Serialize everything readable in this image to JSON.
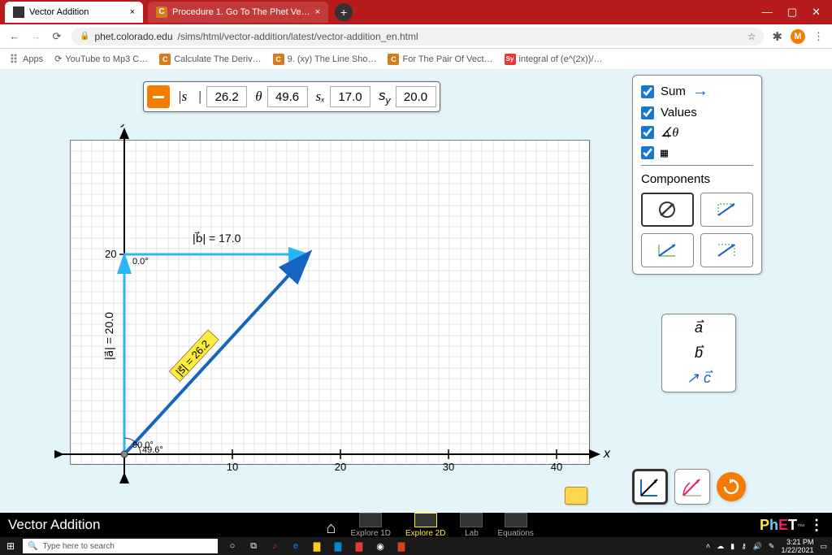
{
  "browser": {
    "tabs": [
      {
        "title": "Vector Addition",
        "icon": "phet"
      },
      {
        "title": "Procedure 1. Go To The Phet Ve…",
        "icon": "chegg"
      }
    ],
    "url_host": "phet.colorado.edu",
    "url_path": "/sims/html/vector-addition/latest/vector-addition_en.html",
    "bookmarks": [
      "Apps",
      "YouTube to Mp3 C…",
      "Calculate The Deriv…",
      "9. (xy) The Line Sho…",
      "For The Pair Of Vect…",
      "integral of (e^(2x))/…"
    ]
  },
  "readout": {
    "vec_symbol": "|s⃗|",
    "mag": "26.2",
    "theta_symbol": "θ",
    "theta": "49.6",
    "sx_symbol": "sₓ",
    "sx": "17.0",
    "sy_symbol": "s",
    "sy_sub": "y",
    "sy": "20.0"
  },
  "controls": {
    "sum_label": "Sum",
    "values_label": "Values",
    "components_label": "Components"
  },
  "palette": {
    "a": "a",
    "b": "b",
    "c": "c"
  },
  "graph": {
    "xlabel": "x",
    "ylabel": "y",
    "x_ticks": [
      "10",
      "20",
      "30",
      "40"
    ],
    "y_tick": "20",
    "vec_b_label": "|b⃗| = 17.0",
    "vec_a_label": "|a⃗| = 20.0",
    "vec_s_label": "|s⃗| = 26.2",
    "angle_a": "90.0°",
    "angle_b": "0.0°",
    "angle_s": "49.6°"
  },
  "chart_data": {
    "type": "vector-plot",
    "title": "Vector Addition",
    "xlabel": "x",
    "ylabel": "y",
    "xlim": [
      -3,
      45
    ],
    "ylim": [
      -3,
      25
    ],
    "vectors": [
      {
        "name": "a",
        "x0": 0,
        "y0": 0,
        "dx": 0,
        "dy": 20,
        "mag": 20.0,
        "angle": 90.0,
        "color": "#29b6f6"
      },
      {
        "name": "b",
        "x0": 0,
        "y0": 20,
        "dx": 17,
        "dy": 0,
        "mag": 17.0,
        "angle": 0.0,
        "color": "#29b6f6"
      },
      {
        "name": "s",
        "x0": 0,
        "y0": 0,
        "dx": 17,
        "dy": 20,
        "mag": 26.2,
        "angle": 49.6,
        "color": "#1565c0",
        "sum": true
      }
    ]
  },
  "sim_nav": {
    "title": "Vector Addition",
    "screens": [
      "Explore 1D",
      "Explore 2D",
      "Lab",
      "Equations"
    ],
    "active": "Explore 2D",
    "logo": "PhET"
  },
  "taskbar": {
    "search_placeholder": "Type here to search",
    "time": "3:21 PM",
    "date": "1/22/2021"
  }
}
